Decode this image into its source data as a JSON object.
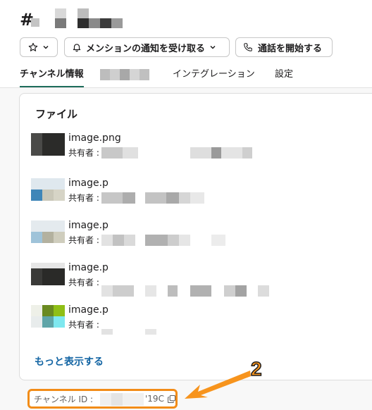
{
  "header": {
    "hash_symbol": "#",
    "title_redacted": true
  },
  "toolbar": {
    "star_button": {
      "icon": "star-icon",
      "dropdown_icon": "chevron-down-icon"
    },
    "mention_button": {
      "icon": "bell-icon",
      "label": "メンションの通知を受け取る",
      "dropdown_icon": "chevron-down-icon"
    },
    "call_button": {
      "icon": "phone-icon",
      "label": "通話を開始する"
    }
  },
  "tabs": [
    {
      "label": "チャンネル情報",
      "active": true
    },
    {
      "label": "",
      "redacted": true
    },
    {
      "label": "インテグレーション",
      "active": false
    },
    {
      "label": "設定",
      "active": false
    }
  ],
  "files_card": {
    "title": "ファイル",
    "items": [
      {
        "name": "image.png",
        "owner_label": "共有者 :"
      },
      {
        "name": "image.p",
        "owner_label": "共有者 :"
      },
      {
        "name": "image.p",
        "owner_label": "共有者 :"
      },
      {
        "name": "image.p",
        "owner_label": "共有者 :"
      },
      {
        "name": "image.p",
        "owner_label": "共有者 :"
      }
    ],
    "more_link": "もっと表示する"
  },
  "footer": {
    "channel_id_label": "チャンネル ID :",
    "channel_id_suffix": "'19C",
    "copy_icon": "copy-icon"
  },
  "annotation": {
    "number": "2",
    "color": "#f7941d"
  },
  "colors": {
    "accent_tab": "#1d6c5b",
    "link": "#1264a3",
    "highlight": "#f28c18"
  }
}
